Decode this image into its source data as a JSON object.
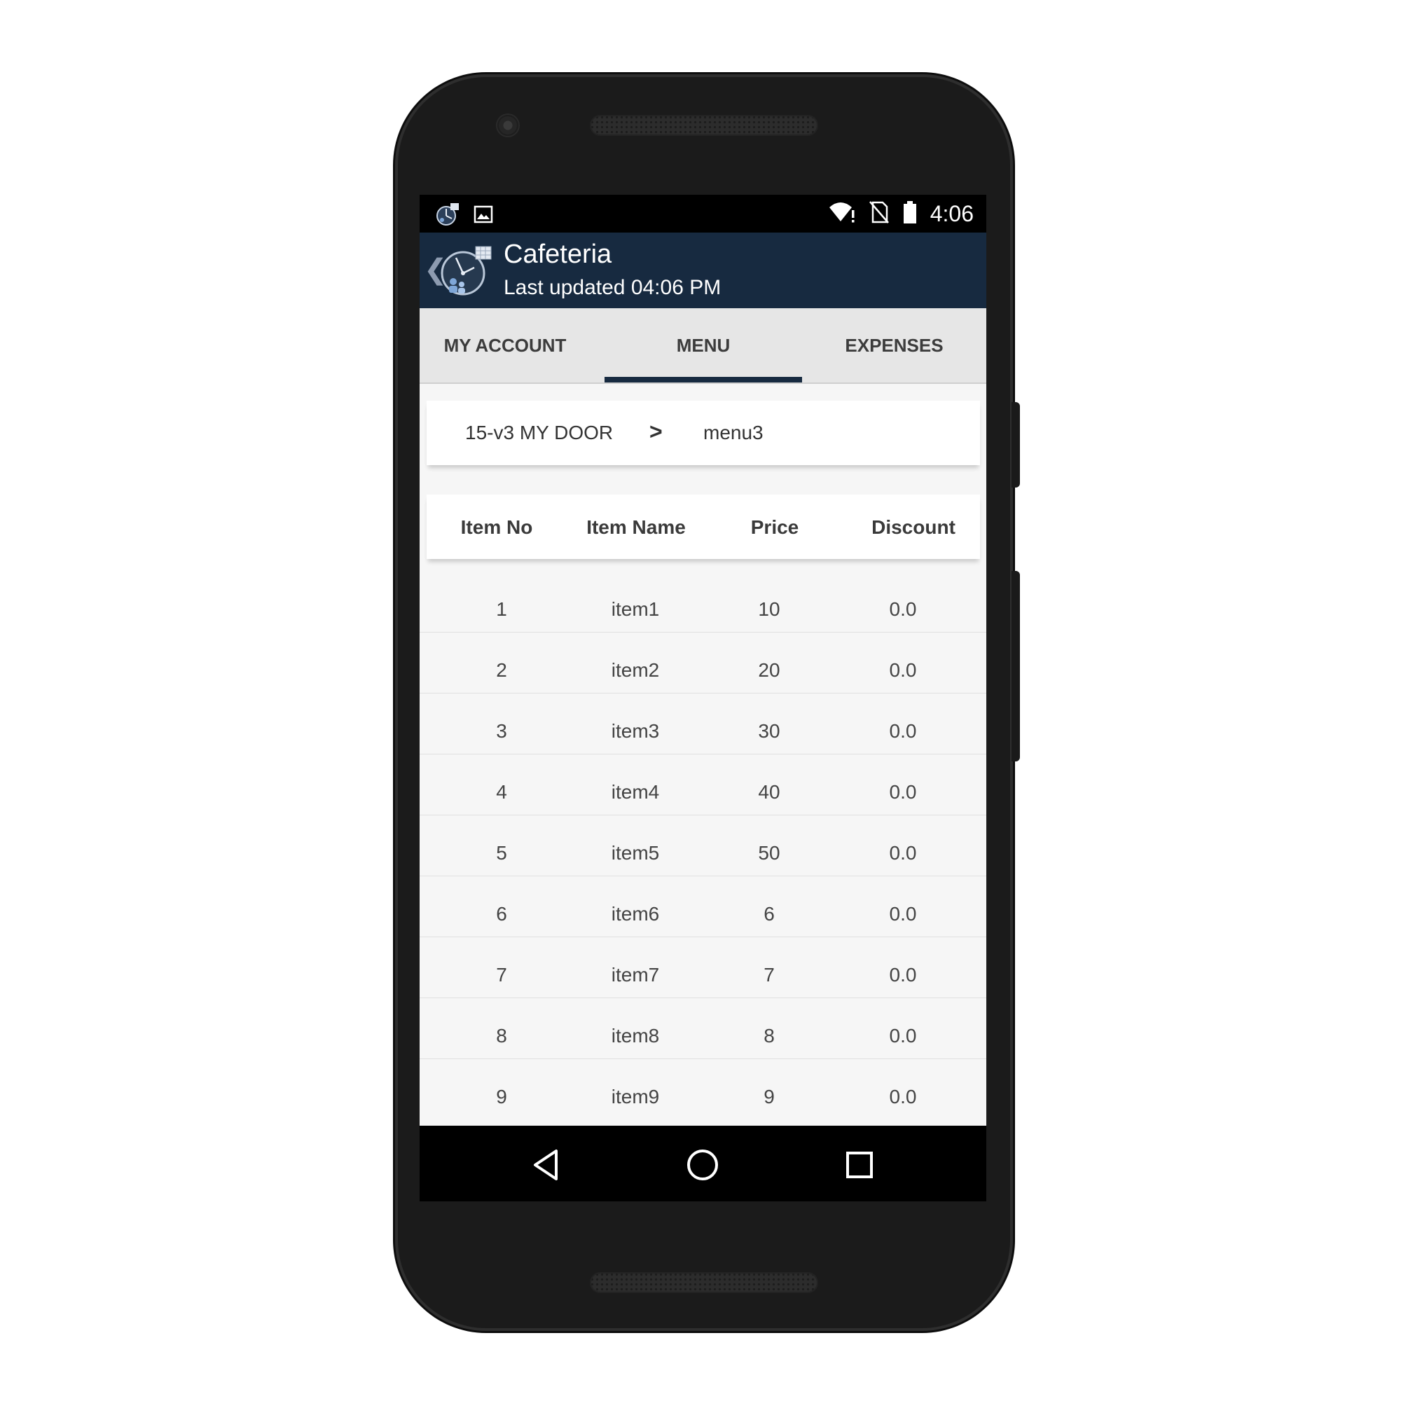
{
  "status_bar": {
    "time": "4:06",
    "left_icons": [
      "app-notification-icon",
      "image-icon"
    ],
    "right_icons": [
      "wifi-alert-icon",
      "no-sim-icon",
      "battery-icon"
    ]
  },
  "app_bar": {
    "title": "Cafeteria",
    "subtitle": "Last updated 04:06 PM",
    "back_glyph": "❮",
    "color": "#172a40"
  },
  "tabs": [
    {
      "label": "MY ACCOUNT",
      "selected": false
    },
    {
      "label": "MENU",
      "selected": true
    },
    {
      "label": "EXPENSES",
      "selected": false
    }
  ],
  "breadcrumb": {
    "location": "15-v3 MY DOOR",
    "separator": ">",
    "current": "menu3"
  },
  "table": {
    "headers": [
      "Item No",
      "Item Name",
      "Price",
      "Discount"
    ],
    "rows": [
      [
        "1",
        "item1",
        "10",
        "0.0"
      ],
      [
        "2",
        "item2",
        "20",
        "0.0"
      ],
      [
        "3",
        "item3",
        "30",
        "0.0"
      ],
      [
        "4",
        "item4",
        "40",
        "0.0"
      ],
      [
        "5",
        "item5",
        "50",
        "0.0"
      ],
      [
        "6",
        "item6",
        "6",
        "0.0"
      ],
      [
        "7",
        "item7",
        "7",
        "0.0"
      ],
      [
        "8",
        "item8",
        "8",
        "0.0"
      ],
      [
        "9",
        "item9",
        "9",
        "0.0"
      ]
    ]
  },
  "nav_bar": {
    "buttons": [
      "back-triangle-icon",
      "home-circle-icon",
      "recents-square-icon"
    ]
  }
}
